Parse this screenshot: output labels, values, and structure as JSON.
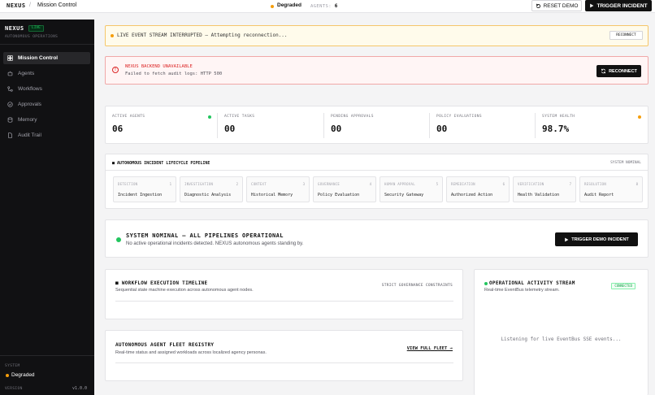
{
  "topbar": {
    "brand": "NEXUS",
    "separator": "/",
    "page": "Mission Control",
    "status": "Degraded",
    "agents_label": "AGENTS:",
    "agents_count": "6",
    "reset_label": "RESET DEMO",
    "trigger_label": "TRIGGER INCIDENT"
  },
  "sidebar": {
    "brand": "NEXUS",
    "badge": "LIVE",
    "subtitle": "AUTONOMOUS OPERATIONS",
    "items": [
      {
        "label": "Mission Control",
        "icon": "grid-icon"
      },
      {
        "label": "Agents",
        "icon": "bot-icon"
      },
      {
        "label": "Workflows",
        "icon": "workflow-icon"
      },
      {
        "label": "Approvals",
        "icon": "check-circle-icon"
      },
      {
        "label": "Memory",
        "icon": "database-icon"
      },
      {
        "label": "Audit Trail",
        "icon": "file-icon"
      }
    ],
    "system_label": "SYSTEM",
    "system_status": "Degraded",
    "version_label": "VERSION",
    "version": "v1.0.0"
  },
  "warning": {
    "text": "LIVE EVENT STREAM INTERRUPTED — Attempting reconnection...",
    "button": "RECONNECT"
  },
  "error": {
    "title": "NEXUS BACKEND UNAVAILABLE",
    "description": "Failed to fetch audit logs: HTTP 500",
    "button": "RECONNECT"
  },
  "metrics": [
    {
      "label": "ACTIVE AGENTS",
      "value": "06",
      "indicator": "#22c55e"
    },
    {
      "label": "ACTIVE TASKS",
      "value": "00"
    },
    {
      "label": "PENDING APPROVALS",
      "value": "00"
    },
    {
      "label": "POLICY EVALUATIONS",
      "value": "00"
    },
    {
      "label": "SYSTEM HEALTH",
      "value": "98.7%",
      "indicator": "#f59e0b"
    }
  ],
  "pipeline": {
    "title": "AUTONOMOUS INCIDENT LIFECYCLE PIPELINE",
    "status": "SYSTEM NOMINAL",
    "stages": [
      {
        "tag": "DETECTION",
        "num": "1",
        "name": "Incident Ingestion"
      },
      {
        "tag": "INVESTIGATION",
        "num": "2",
        "name": "Diagnostic Analysis"
      },
      {
        "tag": "CONTEXT",
        "num": "3",
        "name": "Historical Memory"
      },
      {
        "tag": "GOVERNANCE",
        "num": "4",
        "name": "Policy Evaluation"
      },
      {
        "tag": "HUMAN APPROVAL",
        "num": "5",
        "name": "Security Gateway"
      },
      {
        "tag": "REMEDIATION",
        "num": "6",
        "name": "Authorized Action"
      },
      {
        "tag": "VERIFICATION",
        "num": "7",
        "name": "Health Validation"
      },
      {
        "tag": "RESOLUTION",
        "num": "8",
        "name": "Audit Report"
      }
    ]
  },
  "nominal": {
    "title": "SYSTEM NOMINAL — ALL PIPELINES OPERATIONAL",
    "description": "No active operational incidents detected. NEXUS autonomous agents standing by.",
    "button": "TRIGGER DEMO INCIDENT"
  },
  "timeline": {
    "title": "WORKFLOW EXECUTION TIMELINE",
    "description": "Sequential state machine execution across autonomous agent nodes.",
    "badge": "STRICT GOVERNANCE CONSTRAINTS"
  },
  "fleet": {
    "title": "AUTONOMOUS AGENT FLEET REGISTRY",
    "description": "Real-time status and assigned workloads across localized agency personas.",
    "link": "VIEW FULL FLEET →"
  },
  "stream": {
    "title": "OPERATIONAL ACTIVITY STREAM",
    "description": "Real-time EventBus telemetry stream.",
    "badge": "CONNECTED",
    "empty": "Listening for live EventBus SSE events..."
  },
  "colors": {
    "accent": "#111111",
    "warning": "#f59e0b",
    "error": "#dc2626",
    "success": "#22c55e"
  }
}
